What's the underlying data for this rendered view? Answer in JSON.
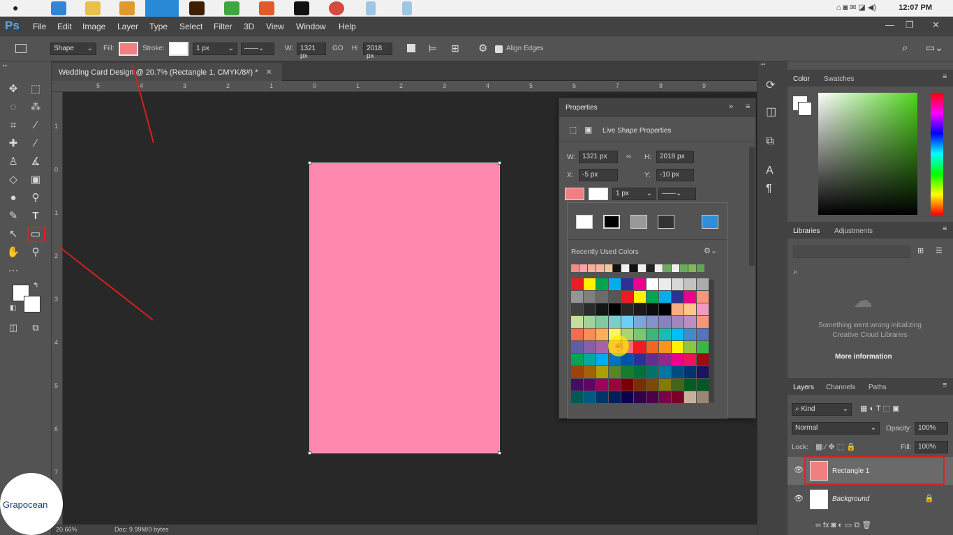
{
  "mac": {
    "clock": "12:07 PM"
  },
  "menubar": {
    "logo": "Ps",
    "items": [
      "File",
      "Edit",
      "Image",
      "Layer",
      "Type",
      "Select",
      "Filter",
      "3D",
      "View",
      "Window",
      "Help"
    ]
  },
  "options": {
    "mode": "Shape",
    "fill_label": "Fill:",
    "fill_color": "#f08080",
    "stroke_label": "Stroke:",
    "stroke_width": "1 px",
    "w_label": "W:",
    "w_value": "1321 px",
    "go_label": "GO",
    "h_label": "H:",
    "h_value": "2018 px",
    "align_edges": "Align Edges"
  },
  "document": {
    "tab_title": "Wedding Card Design @ 20.7% (Rectangle 1, CMYK/8#) *",
    "shape_color": "#ff88ae",
    "zoom": "20.66%",
    "doc_size": "Doc: 9.99M/0 bytes",
    "ruler_top": [
      "5",
      "4",
      "3",
      "2",
      "1",
      "0",
      "1",
      "2",
      "3",
      "4",
      "5",
      "6",
      "7",
      "8",
      "9"
    ],
    "ruler_left": [
      "1",
      "0",
      "1",
      "2",
      "3",
      "4",
      "5",
      "6",
      "7"
    ]
  },
  "properties": {
    "title": "Properties",
    "subtitle": "Live Shape Properties",
    "w_label": "W:",
    "w_value": "1321 px",
    "h_label": "H:",
    "h_value": "2018 px",
    "x_label": "X:",
    "x_value": "-5 px",
    "y_label": "Y:",
    "y_value": "-10 px",
    "stroke_width": "1 px",
    "recent_label": "Recently Used Colors"
  },
  "panels": {
    "color_tab": "Color",
    "swatches_tab": "Swatches",
    "libraries_tab": "Libraries",
    "adjustments_tab": "Adjustments",
    "lib_error": "Something went wrong initializing Creative Cloud Libraries",
    "more_info": "More information",
    "layers_tab": "Layers",
    "channels_tab": "Channels",
    "paths_tab": "Paths",
    "kind": "Kind",
    "blend": "Normal",
    "opacity_label": "Opacity:",
    "opacity": "100%",
    "lock_label": "Lock:",
    "fill_label": "Fill:",
    "fill": "100%",
    "layers": [
      {
        "name": "Rectangle 1"
      },
      {
        "name": "Background"
      }
    ]
  },
  "watermark": "Grapocean",
  "colors": {
    "recent": [
      "#f08a8a",
      "#f4a6a6",
      "#f3b0a0",
      "#f7b79a",
      "#f3c69f",
      "#111111",
      "#f0f0f0",
      "#111111",
      "#f0f0f0",
      "#222222",
      "#f0f0f0",
      "#6bab5e",
      "#f0f0f0",
      "#6bab5e",
      "#80b85c",
      "#5fa554"
    ],
    "grid": [
      [
        "#ed1c24",
        "#fff200",
        "#00a651",
        "#00aeef",
        "#2e3192",
        "#ec008c",
        "#ffffff",
        "#ebebeb",
        "#d7d7d7",
        "#c2c2c2",
        "#ababab"
      ],
      [
        "#959595",
        "#808080",
        "#6b6b6b",
        "#565656",
        "#ed1c24",
        "#fff200",
        "#00a651",
        "#00aeef",
        "#2e3192",
        "#ec008c",
        "#f7977a"
      ],
      [
        "#414141",
        "#2b2b2b",
        "#151515",
        "#000000",
        "#262626",
        "#1a1a1a",
        "#0d0d0d",
        "#000000",
        "#f9ad81",
        "#fdc68a",
        "#f49ac2"
      ],
      [
        "#c4df9b",
        "#a3d39c",
        "#82ca9d",
        "#7bcdc8",
        "#6ecff6",
        "#7ea7d8",
        "#8493ca",
        "#8882be",
        "#a187be",
        "#bc8dbf",
        "#f7977a"
      ],
      [
        "#f26c4f",
        "#f68e55",
        "#fbaf5c",
        "#fff467",
        "#acd372",
        "#7cc576",
        "#3bb878",
        "#1abbb4",
        "#00bff3",
        "#438ccb",
        "#5574b9"
      ],
      [
        "#605ca8",
        "#855fa8",
        "#a763a8",
        "#f06eaa",
        "#f26d7d",
        "#ed1c24",
        "#f26522",
        "#f7941d",
        "#fff200",
        "#8dc63f",
        "#39b54a"
      ],
      [
        "#00a651",
        "#00a99d",
        "#00aeef",
        "#0072bc",
        "#0054a6",
        "#2e3192",
        "#662d91",
        "#92278f",
        "#ec008c",
        "#ed145b",
        "#9e0b0f"
      ],
      [
        "#a0410d",
        "#a36209",
        "#aba000",
        "#598527",
        "#1a7b30",
        "#007236",
        "#00746b",
        "#0076a3",
        "#004b80",
        "#003471",
        "#1b1464"
      ],
      [
        "#440e62",
        "#630460",
        "#9e005d",
        "#9e0039",
        "#790000",
        "#7b2e00",
        "#7d4900",
        "#827b00",
        "#406618",
        "#005e20",
        "#005826"
      ],
      [
        "#005952",
        "#005b7f",
        "#003663",
        "#002157",
        "#0d004c",
        "#32004b",
        "#4b0049",
        "#7b0046",
        "#7a0026",
        "#c7b299",
        "#998675"
      ]
    ],
    "spectrum": [
      "#ff0000",
      "#ff00ff",
      "#0000ff",
      "#00ffff",
      "#00ff00",
      "#ffff00",
      "#ff0000"
    ]
  }
}
